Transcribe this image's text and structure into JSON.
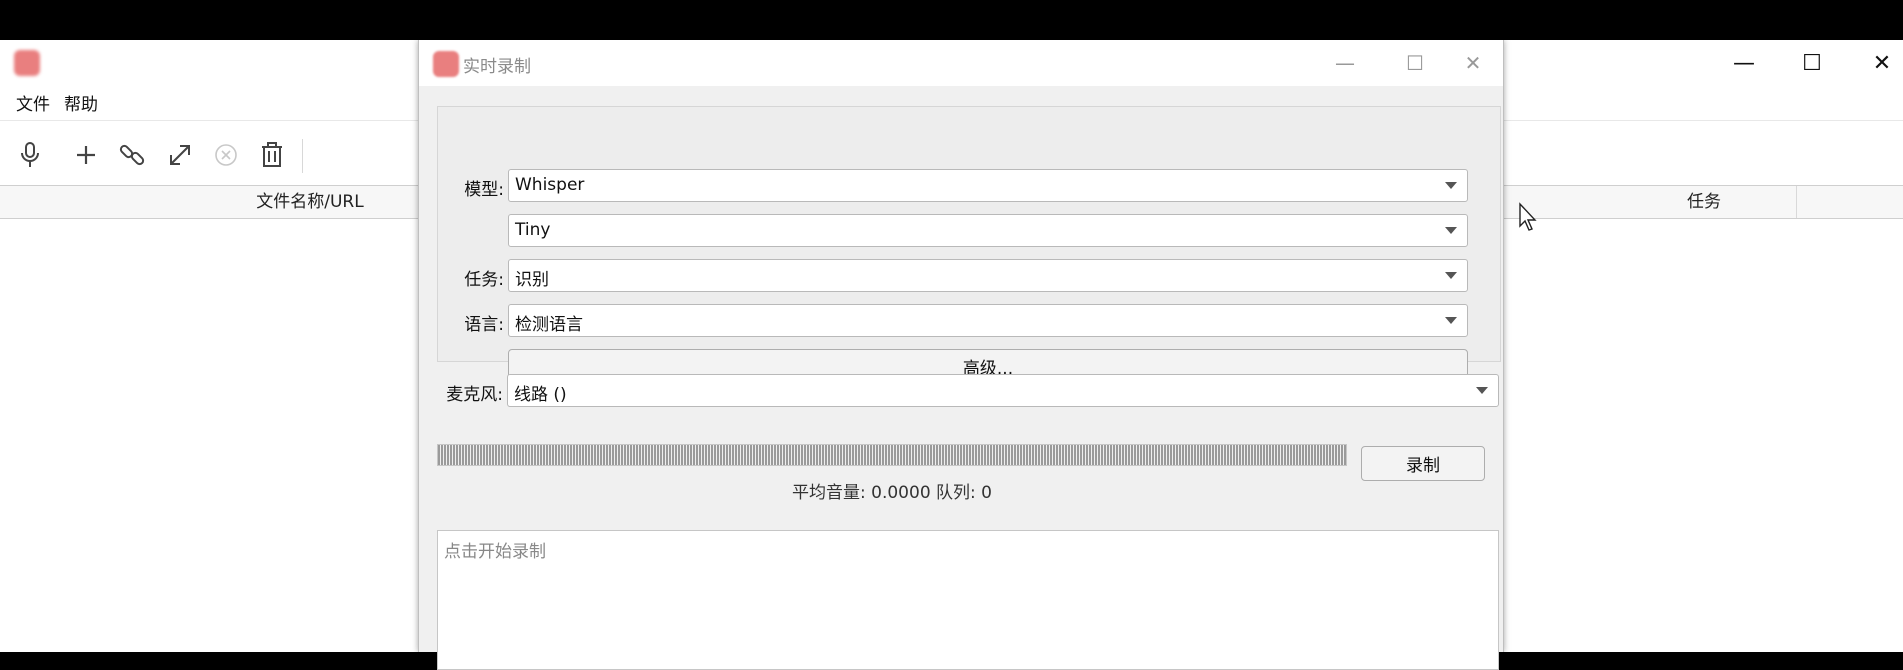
{
  "main_window": {
    "menu": [
      "文件",
      "帮助"
    ],
    "toolbar_icons": [
      "microphone-icon",
      "plus-icon",
      "link-icon",
      "expand-icon",
      "cancel-circle-icon",
      "trash-icon"
    ],
    "table_headers": {
      "file_name": "文件名称/URL",
      "task": "任务"
    },
    "window_controls": {
      "minimize": "—",
      "maximize": "☐",
      "close": "✕"
    }
  },
  "dialog": {
    "title": "实时录制",
    "window_controls": {
      "minimize": "—",
      "maximize": "☐",
      "close": "✕"
    },
    "model_label": "模型:",
    "model_value": "Whisper",
    "model_size_value": "Tiny",
    "task_label": "任务:",
    "task_value": "识别",
    "language_label": "语言:",
    "language_value": "检测语言",
    "advanced_button": "高级...",
    "microphone_label": "麦克风:",
    "microphone_value": "线路 ()",
    "record_button": "录制",
    "status_text": "平均音量: 0.0000   队列: 0",
    "transcript_placeholder": "点击开始录制"
  },
  "colors": {
    "app_icon": "#e97f7f",
    "dialog_bg": "#f0f0f0"
  }
}
